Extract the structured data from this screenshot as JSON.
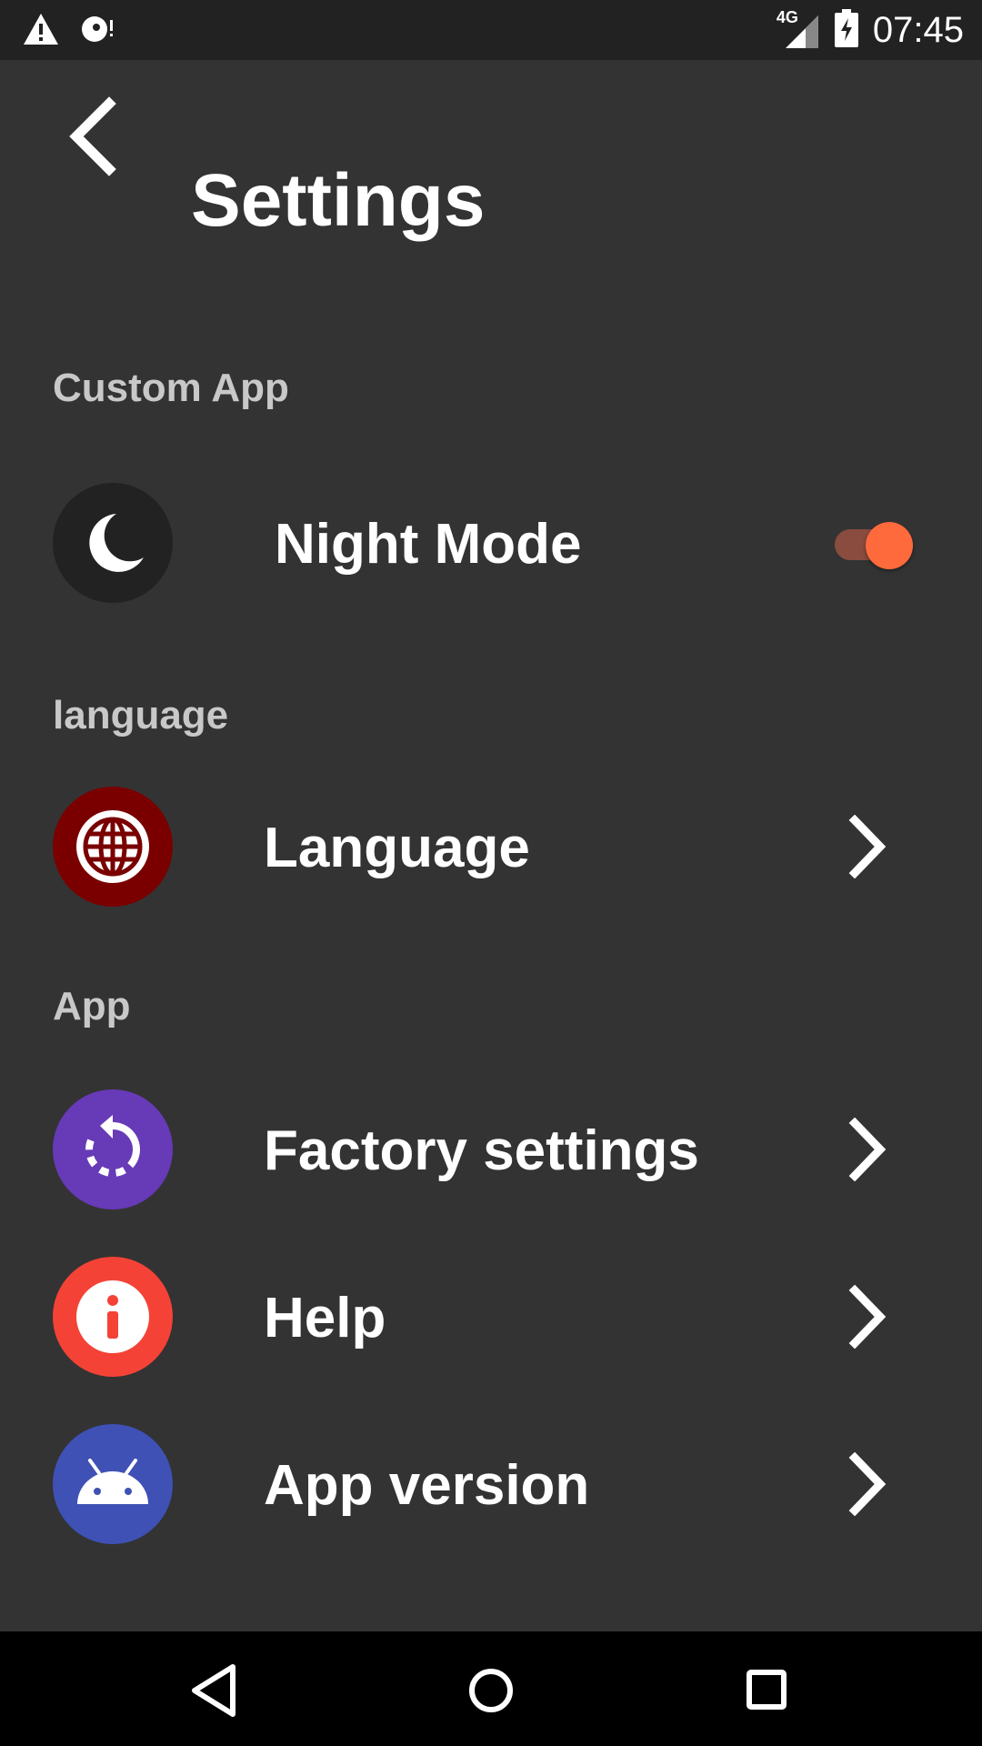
{
  "status_bar": {
    "network": "4G",
    "time": "07:45",
    "icons": [
      "warning-icon",
      "notification-icon",
      "signal-icon",
      "battery-charging-icon"
    ]
  },
  "header": {
    "title": "Settings",
    "back_icon": "chevron-left-icon"
  },
  "sections": {
    "custom_app": "Custom App",
    "language": "language",
    "app": "App"
  },
  "items": {
    "night_mode": {
      "label": "Night Mode",
      "icon": "moon-icon",
      "icon_color": "#222222",
      "enabled": true
    },
    "language": {
      "label": "Language",
      "icon": "globe-icon",
      "icon_color": "#7a0000"
    },
    "factory_settings": {
      "label": "Factory settings",
      "icon": "reset-icon",
      "icon_color": "#673ab7"
    },
    "help": {
      "label": "Help",
      "icon": "info-icon",
      "icon_color": "#f44336"
    },
    "app_version": {
      "label": "App version",
      "icon": "android-icon",
      "icon_color": "#3f51b5"
    }
  },
  "colors": {
    "background": "#333333",
    "status_bar": "#222222",
    "toggle_accent": "#ff6a3d",
    "section_text": "#c8c8c8"
  },
  "nav_bar": {
    "icons": [
      "back-triangle-icon",
      "home-circle-icon",
      "recents-square-icon"
    ]
  }
}
